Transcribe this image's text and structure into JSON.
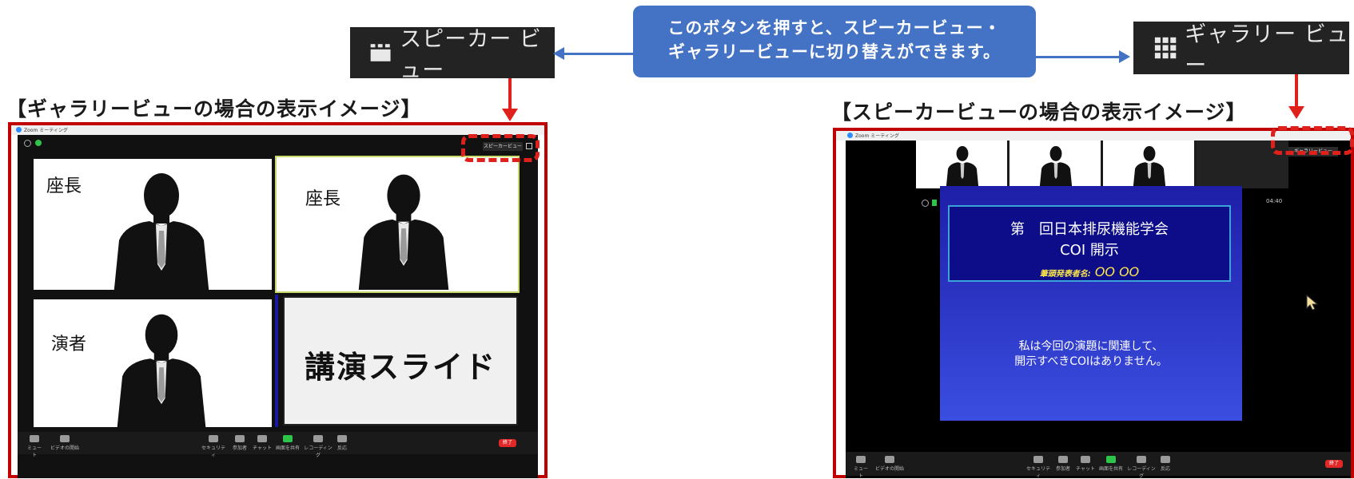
{
  "callout": {
    "line1": "このボタンを押すと、スピーカービュー・",
    "line2": "ギャラリービューに切り替えができます。"
  },
  "buttons": {
    "speaker_view": "スピーカー ビュー",
    "gallery_view": "ギャラリー ビュー"
  },
  "left_panel": {
    "heading": "【ギャラリービューの場合の表示イメージ】",
    "window_title": "Zoom ミーティング",
    "mini_button": "スピーカービュー",
    "tiles": [
      {
        "label": "座長"
      },
      {
        "label": "座長"
      },
      {
        "label": "演者"
      }
    ],
    "slide_tile_label": "講演スライド"
  },
  "right_panel": {
    "heading": "【スピーカービューの場合の表示イメージ】",
    "window_title": "Zoom ミーティング",
    "mini_button": "ギャラリービュー",
    "timer": "04:40",
    "slide": {
      "title_line1": "第　回日本排尿機能学会",
      "title_line2": "COI 開示",
      "presenter_label": "筆頭発表者名:",
      "presenter_name": "OO OO",
      "body_line1": "私は今回の演題に関連して、",
      "body_line2": "開示すべきCOIはありません。"
    }
  },
  "toolbar": {
    "items": [
      "ミュート",
      "ビデオの開始",
      "セキュリティ",
      "参加者",
      "チャット",
      "画面を共有",
      "レコーディング",
      "反応"
    ],
    "end": "終了"
  },
  "colors": {
    "callout_blue": "#4472c4",
    "frame_red": "#c00000",
    "arrow_red": "#e0201b",
    "slide_blue": "#2b2fd0"
  }
}
